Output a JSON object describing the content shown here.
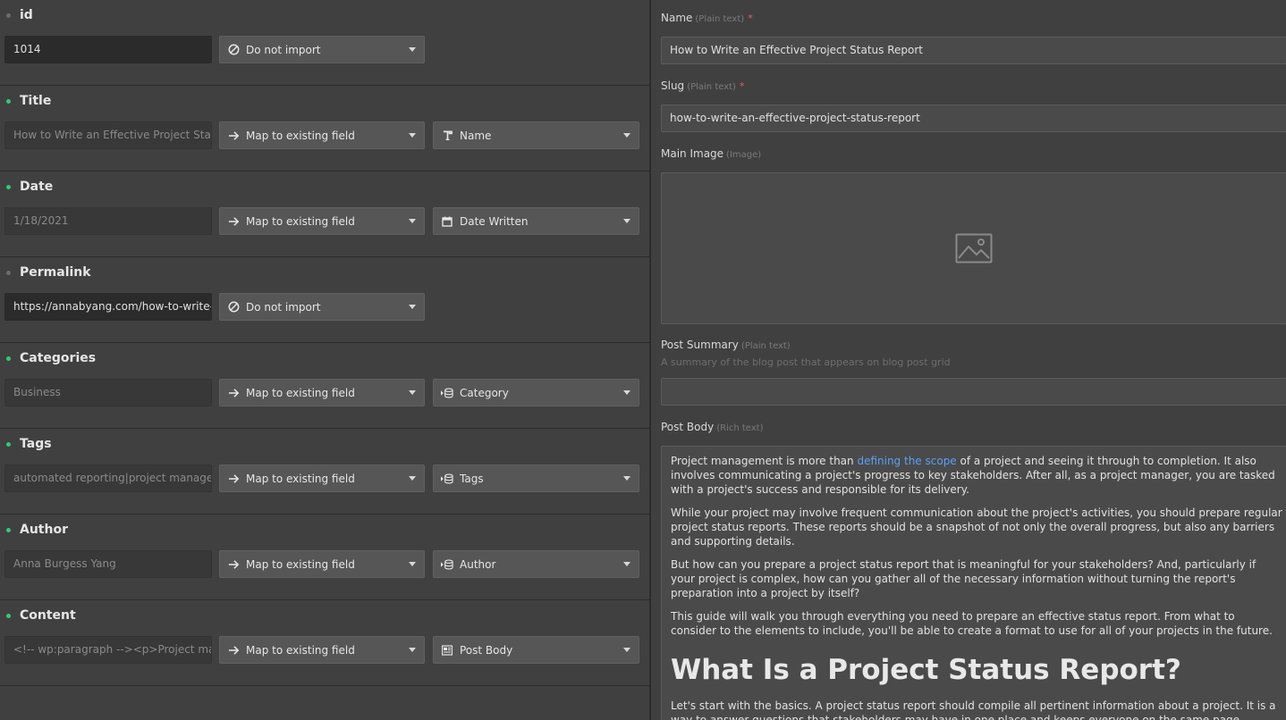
{
  "colors": {
    "dot_active": "#2ecc71",
    "dot_inactive": "#6b6b6b",
    "required": "#ef5a5a",
    "link": "#5aa0f5"
  },
  "fields": [
    {
      "key": "id",
      "label": "id",
      "mapped": false,
      "sample": "1014",
      "action": "Do not import",
      "action_icon": "block-icon"
    },
    {
      "key": "title",
      "label": "Title",
      "mapped": true,
      "sample": "How to Write an Effective Project Stat",
      "action": "Map to existing field",
      "action_icon": "arrow-right-icon",
      "target": "Name",
      "target_icon": "text-type-icon"
    },
    {
      "key": "date",
      "label": "Date",
      "mapped": true,
      "sample": "1/18/2021",
      "action": "Map to existing field",
      "action_icon": "arrow-right-icon",
      "target": "Date Written",
      "target_icon": "calendar-icon"
    },
    {
      "key": "permalink",
      "label": "Permalink",
      "mapped": false,
      "sample": "https://annabyang.com/how-to-write-",
      "action": "Do not import",
      "action_icon": "block-icon"
    },
    {
      "key": "categories",
      "label": "Categories",
      "mapped": true,
      "sample": "Business",
      "action": "Map to existing field",
      "action_icon": "arrow-right-icon",
      "target": "Category",
      "target_icon": "reference-icon"
    },
    {
      "key": "tags",
      "label": "Tags",
      "mapped": true,
      "sample": "automated reporting|project manager",
      "action": "Map to existing field",
      "action_icon": "arrow-right-icon",
      "target": "Tags",
      "target_icon": "reference-icon"
    },
    {
      "key": "author",
      "label": "Author",
      "mapped": true,
      "sample": "Anna Burgess Yang",
      "action": "Map to existing field",
      "action_icon": "arrow-right-icon",
      "target": "Author",
      "target_icon": "reference-icon"
    },
    {
      "key": "content",
      "label": "Content",
      "mapped": true,
      "sample": "<!-- wp:paragraph --><p>Project mar",
      "action": "Map to existing field",
      "action_icon": "arrow-right-icon",
      "target": "Post Body",
      "target_icon": "rich-text-icon"
    }
  ],
  "preview": {
    "name": {
      "label": "Name",
      "type": "(Plain text)",
      "required": "*",
      "value": "How to Write an Effective Project Status Report"
    },
    "slug": {
      "label": "Slug",
      "type": "(Plain text)",
      "required": "*",
      "value": "how-to-write-an-effective-project-status-report"
    },
    "main_image": {
      "label": "Main Image",
      "type": "(Image)"
    },
    "summary": {
      "label": "Post Summary",
      "type": "(Plain text)",
      "help": "A summary of the blog post that appears on blog post grid",
      "value": ""
    },
    "body": {
      "label": "Post Body",
      "type": "(Rich text)",
      "p1_before": "Project management is more than ",
      "p1_link": "defining the scope",
      "p1_after": " of a project and seeing it through to completion. It also involves communicating a project's progress to key stakeholders. After all, as a project manager, you are tasked with a project's success and responsible for its delivery.",
      "p2": "While your project may involve frequent communication about the project's activities, you should prepare regular project status reports. These reports should be a snapshot of not only the overall progress, but also any barriers and supporting details.",
      "p3": "But how can you prepare a project status report that is meaningful for your stakeholders? And, particularly if your project is complex, how can you gather all of the necessary information without turning the report's preparation into a project by itself?",
      "p4": "This guide will walk you through everything you need to prepare an effective status report. From what to consider to the elements to include, you'll be able to create a format to use for all of your projects in the future.",
      "h2": "What Is a Project Status Report?",
      "p5": "Let's start with the basics. A project status report should compile all pertinent information about a project. It is a way to answer questions that stakeholders may have in one place and keeps everyone on the same page."
    }
  }
}
